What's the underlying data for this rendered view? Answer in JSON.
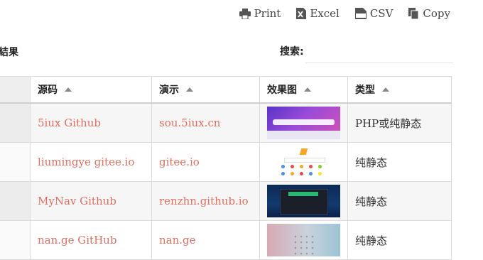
{
  "toolbar": {
    "print": "Print",
    "excel": "Excel",
    "csv": "CSV",
    "copy": "Copy"
  },
  "page_title_partial": "結果",
  "search": {
    "label": "搜索:",
    "value": ""
  },
  "table": {
    "headers": [
      "",
      "源码",
      "演示",
      "效果图",
      "类型"
    ],
    "rows": [
      {
        "source": "5iux Github",
        "demo": "sou.5iux.cn",
        "thumb": "5iux-preview",
        "type": "PHP或纯静态"
      },
      {
        "source": "liumingye gitee.io",
        "demo": "gitee.io",
        "thumb": "liumingye-preview",
        "type": "纯静态"
      },
      {
        "source": "MyNav Github",
        "demo": "renzhn.github.io",
        "thumb": "mynav-preview",
        "type": "纯静态"
      },
      {
        "source": "nan.ge GitHub",
        "demo": "nan.ge",
        "thumb": "nange-preview",
        "type": "纯静态"
      }
    ]
  },
  "colors": {
    "link": "#e07060",
    "border": "#dcdcdc",
    "stripe": "#f6f6f6"
  }
}
